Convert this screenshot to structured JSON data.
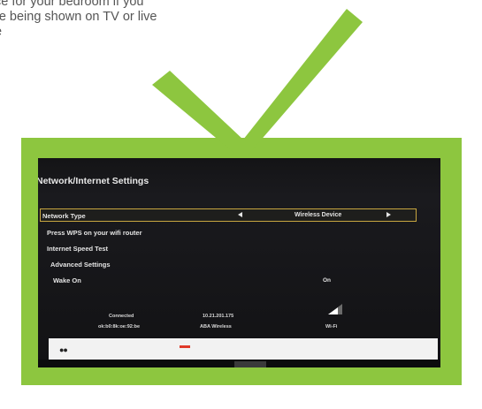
{
  "caption": {
    "line1": "ce for your bedroom if you",
    "line2": "re being shown on TV or live",
    "line3": "e"
  },
  "colors": {
    "accent_green": "#8dc63f",
    "tv_background": "#141416",
    "selection_border": "#c8a640",
    "red_key": "#e03a2a"
  },
  "tv_screen": {
    "title": "Network/Internet Settings",
    "menu": [
      {
        "label": "Network Type",
        "value": "Wireless Device",
        "selected": true
      },
      {
        "label": "Press WPS on your wifi router"
      },
      {
        "label": "Internet Speed Test"
      },
      {
        "label": "Advanced Settings"
      },
      {
        "label": "Wake On",
        "value": "On"
      }
    ],
    "status": {
      "state": "Connected",
      "mac": "ok:b0:8k:oe:92:be",
      "ip": "10.21.201.175",
      "ssid": "ABA Wireless",
      "interface": "Wi-Fi"
    },
    "icons": {
      "left_arrow": "left-arrow-icon",
      "right_arrow": "right-arrow-icon",
      "signal": "wifi-signal-icon",
      "checkmark": "checkmark-icon"
    }
  }
}
